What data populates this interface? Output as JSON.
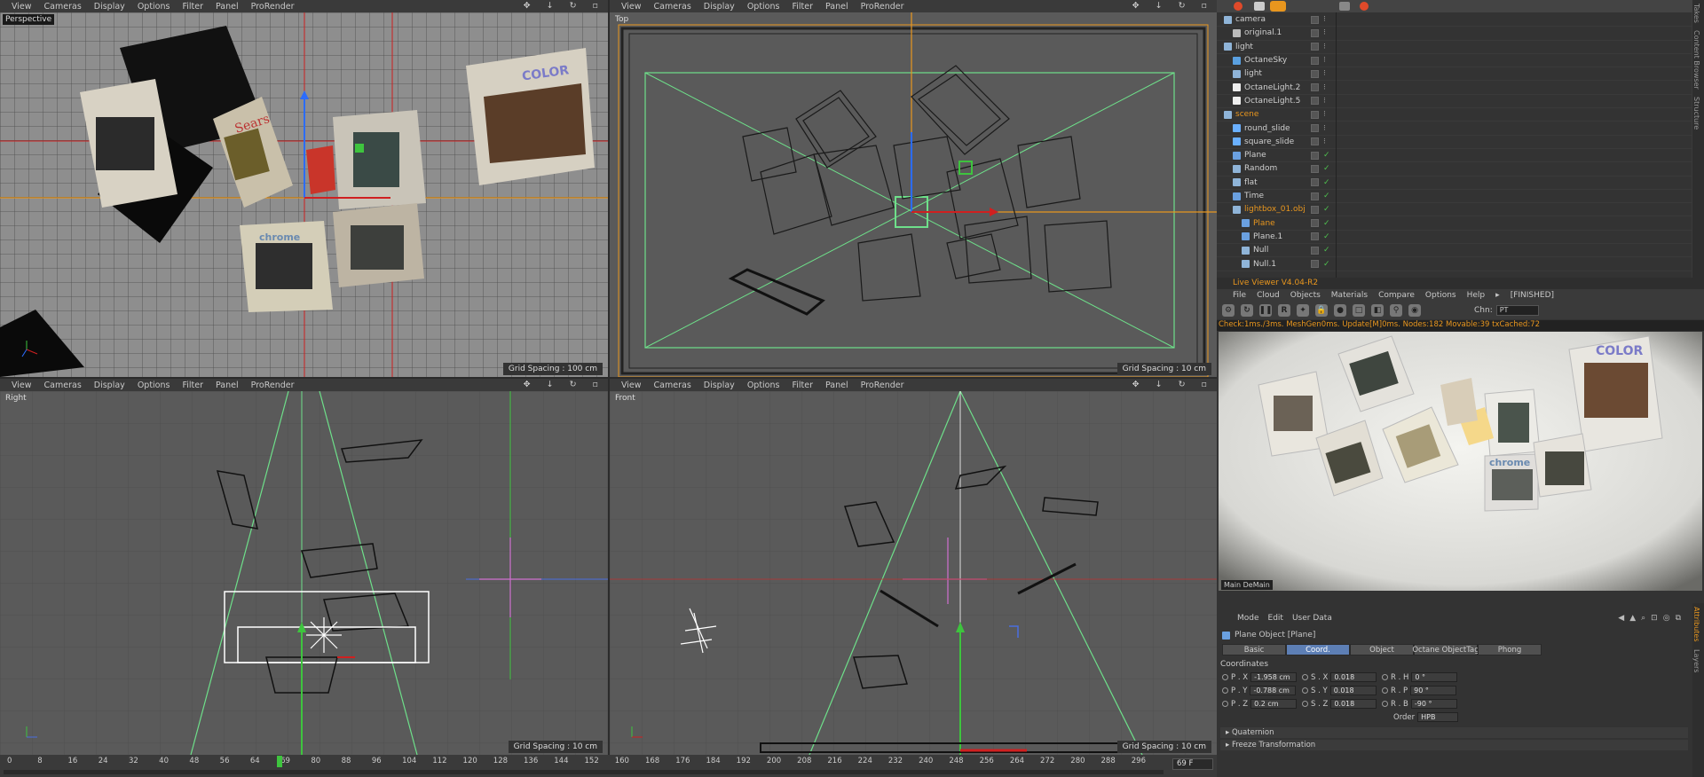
{
  "viewport_menu": [
    "View",
    "Cameras",
    "Display",
    "Options",
    "Filter",
    "Panel",
    "ProRender"
  ],
  "viewports": {
    "perspective": {
      "label": "Perspective",
      "grid_spacing": "Grid Spacing : 100 cm"
    },
    "top": {
      "label": "Top",
      "grid_spacing": "Grid Spacing : 10 cm"
    },
    "right": {
      "label": "Right",
      "grid_spacing": "Grid Spacing : 10 cm"
    },
    "front": {
      "label": "Front",
      "grid_spacing": "Grid Spacing : 10 cm"
    }
  },
  "slides_text": {
    "color_a": "COLOR",
    "sears": "Sears",
    "chrome": "chrome",
    "color_b": "COLOR"
  },
  "object_manager": {
    "items": [
      {
        "name": "camera",
        "indent": 0,
        "icon": "null-icon",
        "color": "#cfcfcf"
      },
      {
        "name": "original.1",
        "indent": 1,
        "icon": "camera-icon",
        "color": "#cfcfcf"
      },
      {
        "name": "light",
        "indent": 0,
        "icon": "null-icon",
        "color": "#cfcfcf"
      },
      {
        "name": "OctaneSky",
        "indent": 1,
        "icon": "sky-icon",
        "color": "#cfcfcf"
      },
      {
        "name": "light",
        "indent": 1,
        "icon": "null-icon",
        "color": "#cfcfcf"
      },
      {
        "name": "OctaneLight.2",
        "indent": 1,
        "icon": "light-icon",
        "color": "#cfcfcf"
      },
      {
        "name": "OctaneLight.5",
        "indent": 1,
        "icon": "light-icon",
        "color": "#cfcfcf"
      },
      {
        "name": "scene",
        "indent": 0,
        "icon": "null-icon",
        "color": "#e8961e"
      },
      {
        "name": "round_slide",
        "indent": 1,
        "icon": "cloner-icon",
        "color": "#cfcfcf"
      },
      {
        "name": "square_slide",
        "indent": 1,
        "icon": "cloner-icon",
        "color": "#cfcfcf"
      },
      {
        "name": "Plane",
        "indent": 1,
        "icon": "plane-icon",
        "color": "#cfcfcf"
      },
      {
        "name": "Random",
        "indent": 1,
        "icon": "effector-icon",
        "color": "#cfcfcf"
      },
      {
        "name": "flat",
        "indent": 1,
        "icon": "null-icon",
        "color": "#cfcfcf"
      },
      {
        "name": "Time",
        "indent": 1,
        "icon": "time-icon",
        "color": "#cfcfcf"
      },
      {
        "name": "lightbox_01.obj",
        "indent": 1,
        "icon": "null-icon",
        "color": "#e8961e"
      },
      {
        "name": "Plane",
        "indent": 2,
        "icon": "plane-icon",
        "color": "#e8961e"
      },
      {
        "name": "Plane.1",
        "indent": 2,
        "icon": "plane-icon",
        "color": "#cfcfcf"
      },
      {
        "name": "Null",
        "indent": 2,
        "icon": "null-icon",
        "color": "#cfcfcf"
      },
      {
        "name": "Null.1",
        "indent": 2,
        "icon": "null-icon",
        "color": "#cfcfcf"
      }
    ]
  },
  "live_viewer": {
    "title": "Live Viewer V4.04-R2",
    "menu": [
      "File",
      "Cloud",
      "Objects",
      "Materials",
      "Compare",
      "Options",
      "Help",
      "▸",
      "[FINISHED]"
    ],
    "chn_label": "Chn:",
    "chn_value": "PT",
    "status": "Check:1ms./3ms. MeshGen0ms. Update[M]0ms. Nodes:182 Movable:39 txCached:72",
    "tabs": "Main  DeMain",
    "render_texts": {
      "color": "COLOR",
      "chrome": "chrome"
    }
  },
  "attributes": {
    "menu": [
      "Mode",
      "Edit",
      "User Data"
    ],
    "title": "Plane Object [Plane]",
    "tabs": [
      "Basic",
      "Coord.",
      "Object",
      "Octane ObjectTag",
      "Phong"
    ],
    "active_tab": "Coord.",
    "section": "Coordinates",
    "fields": {
      "px": {
        "label": "P . X",
        "value": "-1.958 cm"
      },
      "py": {
        "label": "P . Y",
        "value": "-0.788 cm"
      },
      "pz": {
        "label": "P . Z",
        "value": "0.2 cm"
      },
      "sx": {
        "label": "S . X",
        "value": "0.018"
      },
      "sy": {
        "label": "S . Y",
        "value": "0.018"
      },
      "sz": {
        "label": "S . Z",
        "value": "0.018"
      },
      "rh": {
        "label": "R . H",
        "value": "0 °"
      },
      "rp": {
        "label": "R . P",
        "value": "90 °"
      },
      "rb": {
        "label": "R . B",
        "value": "-90 °"
      }
    },
    "order_label": "Order",
    "order_value": "HPB",
    "collapsed": [
      "Quaternion",
      "Freeze Transformation"
    ]
  },
  "side_tabs_top": [
    "Takes",
    "Content Browser",
    "Structure"
  ],
  "side_tabs_bottom": [
    "Attributes",
    "Layers"
  ],
  "timeline": {
    "ticks": [
      "0",
      "8",
      "16",
      "24",
      "32",
      "40",
      "48",
      "56",
      "64",
      "69",
      "80",
      "88",
      "96",
      "104",
      "112",
      "120",
      "128",
      "136",
      "144",
      "152",
      "160",
      "168",
      "176",
      "184",
      "192",
      "200",
      "208",
      "216",
      "224",
      "232",
      "240",
      "248",
      "256",
      "264",
      "272",
      "280",
      "288",
      "296"
    ],
    "current_frame": "69 F"
  },
  "colors": {
    "accent": "#e8961e",
    "active_tab": "#5d7fb5",
    "axis_green": "#3ec43e",
    "axis_red": "#d02020"
  }
}
